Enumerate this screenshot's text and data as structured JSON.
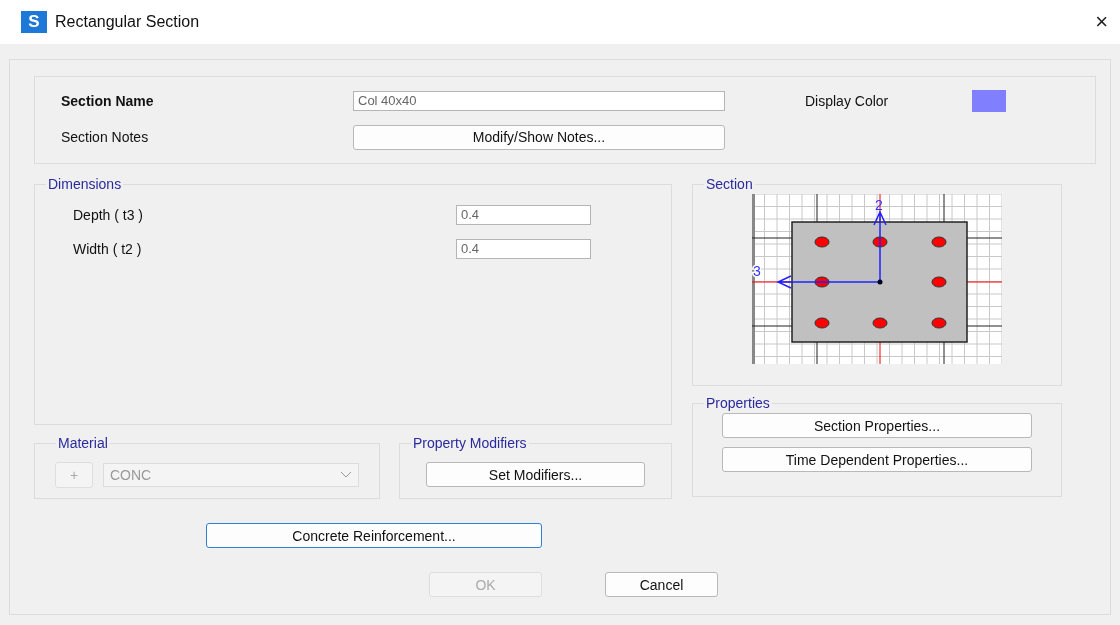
{
  "window": {
    "title": "Rectangular Section",
    "app_icon": "S",
    "close": "×"
  },
  "section_name": {
    "label": "Section Name",
    "value": "Col 40x40"
  },
  "section_notes": {
    "label": "Section Notes",
    "button": "Modify/Show Notes..."
  },
  "display_color": {
    "label": "Display Color",
    "color": "#8080ff"
  },
  "dimensions": {
    "title": "Dimensions",
    "fields": [
      {
        "label": "Depth  ( t3 )",
        "value": "0.4"
      },
      {
        "label": "Width  ( t2 )",
        "value": "0.4"
      }
    ]
  },
  "section": {
    "title": "Section",
    "axis_2": "2",
    "axis_3": "3"
  },
  "properties": {
    "title": "Properties",
    "buttons": [
      "Section Properties...",
      "Time Dependent Properties..."
    ]
  },
  "material": {
    "title": "Material",
    "add_button": "+",
    "value": "CONC",
    "disabled": true
  },
  "property_modifiers": {
    "title": "Property Modifiers",
    "button": "Set Modifiers..."
  },
  "reinforcement_button": {
    "label": "Concrete Reinforcement...",
    "focused": true
  },
  "buttons": [
    {
      "label": "OK",
      "disabled": true
    },
    {
      "label": "Cancel",
      "disabled": false
    }
  ]
}
